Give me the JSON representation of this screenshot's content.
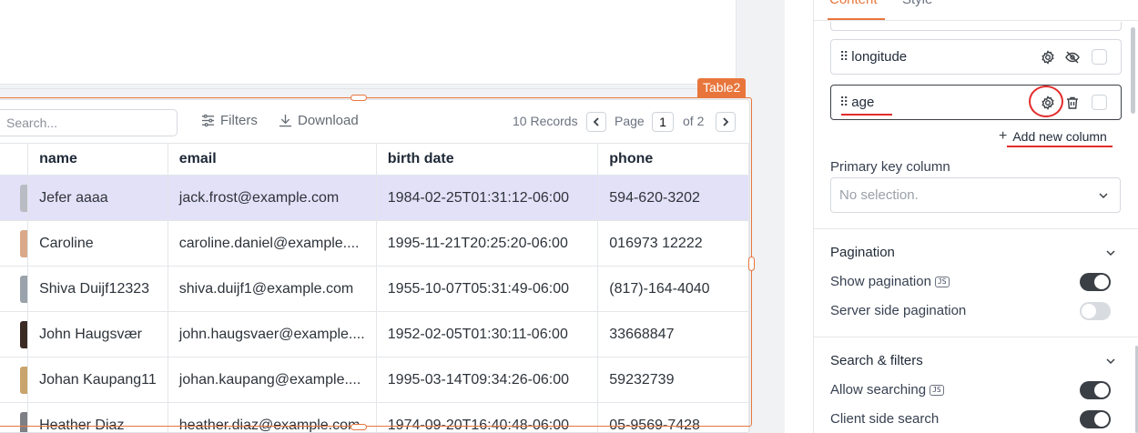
{
  "widget": {
    "name": "Table2"
  },
  "toolbar": {
    "search_placeholder": "Search...",
    "filters_label": "Filters",
    "download_label": "Download",
    "records_label": "10 Records",
    "page_label": "Page",
    "page_value": "1",
    "page_of": "of 2"
  },
  "table": {
    "columns": [
      "name",
      "email",
      "birth date",
      "phone"
    ],
    "rows": [
      {
        "name": "Jefer aaaa",
        "email": "jack.frost@example.com",
        "birth": "1984-02-25T01:31:12-06:00",
        "phone": "594-620-3202"
      },
      {
        "name": "Caroline",
        "email": "caroline.daniel@example....",
        "birth": "1995-11-21T20:25:20-06:00",
        "phone": "016973 12222"
      },
      {
        "name": "Shiva Duijf12323",
        "email": "shiva.duijf1@example.com",
        "birth": "1955-10-07T05:31:49-06:00",
        "phone": "(817)-164-4040"
      },
      {
        "name": "John Haugsvær",
        "email": "john.haugsvaer@example....",
        "birth": "1952-02-05T01:30:11-06:00",
        "phone": "33668847"
      },
      {
        "name": "Johan Kaupang11",
        "email": "johan.kaupang@example....",
        "birth": "1995-03-14T09:34:26-06:00",
        "phone": "59232739"
      },
      {
        "name": "Heather Diaz",
        "email": "heather.diaz@example.com",
        "birth": "1974-09-20T16:40:48-06:00",
        "phone": "05-9569-7428"
      }
    ]
  },
  "panel": {
    "tabs": [
      "Content",
      "Style"
    ],
    "columns": [
      {
        "label": "longitude"
      },
      {
        "label": "age"
      }
    ],
    "add_column_label": "Add new column",
    "primary_key_label": "Primary key column",
    "primary_key_placeholder": "No selection.",
    "pagination": {
      "title": "Pagination",
      "show_pagination": "Show pagination",
      "server_side": "Server side pagination"
    },
    "search": {
      "title": "Search & filters",
      "allow_searching": "Allow searching",
      "client_side": "Client side search"
    },
    "js_badge": "JS"
  },
  "colors": {
    "accent": "#e8763c",
    "selected_row": "#e3e1f8",
    "annotation_red": "#e22c2c",
    "toggle_on": "#3a3f45"
  },
  "toggles": {
    "show_pagination": true,
    "server_side_pagination": false,
    "allow_searching": true,
    "client_side_search": true
  }
}
